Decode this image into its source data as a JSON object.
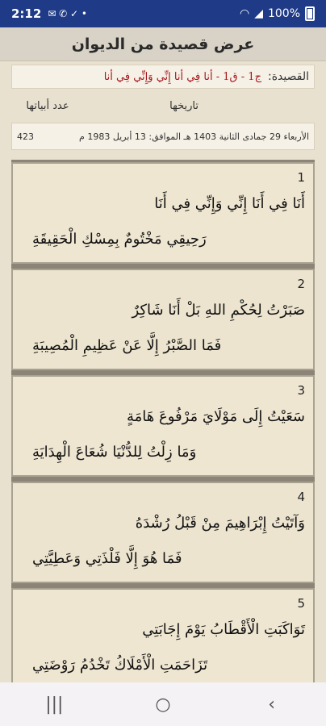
{
  "status": {
    "time": "2:12",
    "icons": "✉ ✆ ✓ •",
    "battery": "100%"
  },
  "app": {
    "title": "عرض قصيدة من الديوان"
  },
  "poem": {
    "label": "القصيدة:",
    "name": "ج1 - ق1 - أنا فِي أنا إِنِّي وَإِنِّي فِي أنا",
    "date_header": "تاريخها",
    "count_header": "عدد أبياتها",
    "date_value": "الأربعاء 29 جمادى الثانية 1403 هـ الموافق: 13 أبريل 1983 م",
    "count_value": "423"
  },
  "verses": [
    {
      "num": "1",
      "first": "أَنَا فِي أَنَا إِنِّي وَإِنِّي فِي أَنَا",
      "second": "رَحِيقِي مَخْتُومٌ بِمِسْكِ الْحَقِيقَةِ"
    },
    {
      "num": "2",
      "first": "صَبَرْتُ لِحُكْمِ اللهِ بَلْ أَنَا شَاكِرٌ",
      "second": "فَمَا الصَّبْرُ إِلَّا عَنْ عَظِيمِ الْمُصِيبَةِ"
    },
    {
      "num": "3",
      "first": "سَعَيْتُ إِلَى مَوْلَايَ مَرْفُوعَ هَامَةٍ",
      "second": "وَمَا زِلْتُ لِلدُّنْيَا شُعَاعَ الْهِدَايَةِ"
    },
    {
      "num": "4",
      "first": "وَآتَيْتُ إِبْرَاهِيمَ مِنْ قَبْلُ رُشْدَهُ",
      "second": "فَمَا هُوَ إِلَّا فَلْذَتِي وَعَطِيَّتِي"
    },
    {
      "num": "5",
      "first": "تَوَاكَبَتِ الْأَقْطَابُ يَوْمَ إِجَابَتِي",
      "second": "تَزَاحَمَتِ الْأَمْلَاكُ تَخْدُمُ رَوْضَتِي"
    }
  ],
  "nav": {
    "recents": "|||",
    "home": "○",
    "back": "‹"
  }
}
